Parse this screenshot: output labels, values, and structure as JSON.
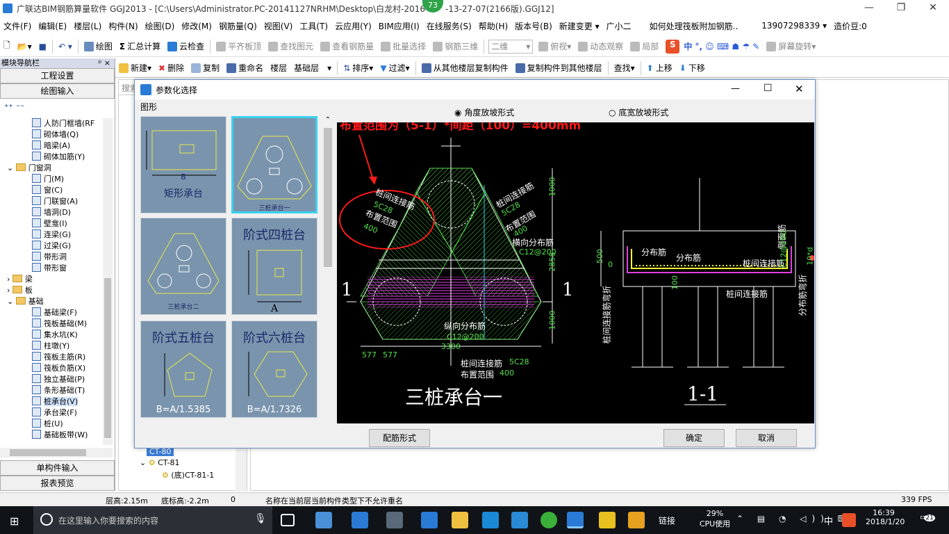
{
  "window": {
    "title": "广联达BIM钢筋算量软件 GGJ2013 - [C:\\Users\\Administrator.PC-20141127NRHM\\Desktop\\白龙村-2016",
    "title_tail": "-13-27-07(2166版).GGJ12]",
    "badge": "73"
  },
  "menu": [
    "文件(F)",
    "编辑(E)",
    "楼层(L)",
    "构件(N)",
    "绘图(D)",
    "修改(M)",
    "钢筋量(Q)",
    "视图(V)",
    "工具(T)",
    "云应用(Y)",
    "BIM应用(I)",
    "在线服务(S)",
    "帮助(H)",
    "版本号(B)",
    "新建变更 ▾",
    "广小二",
    "如何处理筏板附加钢筋..",
    "13907298339 ▾",
    "造价豆:0"
  ],
  "toolbar1": {
    "draw": "绘图",
    "sum": "汇总计算",
    "cloud": "云检查",
    "align": "平齐板顶",
    "find": "查找图元",
    "view_steel": "查看钢筋量",
    "batch": "批量选择",
    "steel3d": "钢筋三维",
    "mode": "二维",
    "view": "俯视",
    "dyn": "动态观察",
    "local": "局部",
    "rotate": "屏幕旋转"
  },
  "toolbar2": {
    "new": "新建",
    "delete": "删除",
    "copy": "复制",
    "rename": "重命名",
    "floor_label": "楼层",
    "floor_value": "基础层",
    "sort": "排序",
    "filter": "过滤",
    "copy_from": "从其他楼层复制构件",
    "copy_to": "复制构件到其他楼层",
    "search": "查找",
    "up": "上移",
    "down": "下移"
  },
  "left_panel": {
    "header": "模块导航栏",
    "pin": "ᵖ ×",
    "btn_settings": "工程设置",
    "btn_draw": "绘图输入",
    "btn_single": "单构件输入",
    "btn_report": "报表预览",
    "search_placeholder": "搜索"
  },
  "tree": [
    {
      "t": "人防门框墙(RF",
      "lvl": 3,
      "ic": "tic"
    },
    {
      "t": "砌体墙(Q)",
      "lvl": 3,
      "ic": "tic"
    },
    {
      "t": "暗梁(A)",
      "lvl": 3,
      "ic": "tic"
    },
    {
      "t": "砌体加筋(Y)",
      "lvl": 3,
      "ic": "tic"
    },
    {
      "t": "门窗洞",
      "lvl": 1,
      "ic": "fold",
      "exp": "⌄"
    },
    {
      "t": "门(M)",
      "lvl": 3,
      "ic": "tic"
    },
    {
      "t": "窗(C)",
      "lvl": 3,
      "ic": "tic"
    },
    {
      "t": "门联窗(A)",
      "lvl": 3,
      "ic": "tic"
    },
    {
      "t": "墙洞(D)",
      "lvl": 3,
      "ic": "tic"
    },
    {
      "t": "壁龛(I)",
      "lvl": 3,
      "ic": "tic"
    },
    {
      "t": "连梁(G)",
      "lvl": 3,
      "ic": "tic"
    },
    {
      "t": "过梁(G)",
      "lvl": 3,
      "ic": "tic"
    },
    {
      "t": "带形洞",
      "lvl": 3,
      "ic": "tic"
    },
    {
      "t": "带形窗",
      "lvl": 3,
      "ic": "tic"
    },
    {
      "t": "梁",
      "lvl": 1,
      "ic": "fold",
      "exp": "›"
    },
    {
      "t": "板",
      "lvl": 1,
      "ic": "fold",
      "exp": "›"
    },
    {
      "t": "基础",
      "lvl": 1,
      "ic": "fold",
      "exp": "⌄"
    },
    {
      "t": "基础梁(F)",
      "lvl": 3,
      "ic": "tic"
    },
    {
      "t": "筏板基础(M)",
      "lvl": 3,
      "ic": "tic"
    },
    {
      "t": "集水坑(K)",
      "lvl": 3,
      "ic": "tic"
    },
    {
      "t": "柱墩(Y)",
      "lvl": 3,
      "ic": "tic"
    },
    {
      "t": "筏板主筋(R)",
      "lvl": 3,
      "ic": "tic"
    },
    {
      "t": "筏板负筋(X)",
      "lvl": 3,
      "ic": "tic"
    },
    {
      "t": "独立基础(P)",
      "lvl": 3,
      "ic": "tic"
    },
    {
      "t": "条形基础(T)",
      "lvl": 3,
      "ic": "tic"
    },
    {
      "t": "桩承台(V)",
      "lvl": 3,
      "ic": "tic",
      "sel": true
    },
    {
      "t": "承台梁(F)",
      "lvl": 3,
      "ic": "tic"
    },
    {
      "t": "桩(U)",
      "lvl": 3,
      "ic": "tic"
    },
    {
      "t": "基础板带(W)",
      "lvl": 3,
      "ic": "tic"
    }
  ],
  "comp_tree": {
    "item1": "CT-80",
    "item2": "CT-81",
    "item3": "(底)CT-81-1"
  },
  "dialog": {
    "title": "参数化选择",
    "shapes_label": "图形",
    "radio1": "角度放坡形式",
    "radio2": "底宽放坡形式",
    "thumbs": [
      {
        "label": "矩形承台",
        "sub": "B"
      },
      {
        "label": "三桩承台一",
        "sub": ""
      },
      {
        "label": "三桩承台二",
        "sub": ""
      },
      {
        "label": "阶式四桩台",
        "sub": "A"
      },
      {
        "label": "阶式五桩台",
        "sub": "B=A/1.5385"
      },
      {
        "label": "阶式六桩台",
        "sub": "B=A/1.7326"
      }
    ],
    "btn_config": "配筋形式",
    "btn_ok": "确定",
    "btn_cancel": "取消"
  },
  "drawing": {
    "annotation": "布置范围为（5-1）*间距（100）=400mm",
    "left_label_1": "桩间连接筋",
    "left_label_2": "5C28",
    "left_label_3": "布置范围",
    "left_label_4": "400",
    "right_label_1": "桩间连接筋",
    "right_label_2": "5C28",
    "right_label_3": "布置范围",
    "right_label_4": "400",
    "trans_label": "横向分布筋",
    "trans_val": "C12@200",
    "long_label": "纵向分布筋",
    "long_val": "C12@200",
    "bottom_label_1": "桩间连接筋",
    "bottom_label_2": "5C28",
    "bottom_label_3": "布置范围",
    "bottom_label_4": "400",
    "dim_1000a": "1000",
    "dim_2858": "2858",
    "dim_1000b": "1000",
    "dim_3300": "3300",
    "dim_577a": "577",
    "dim_577b": "577",
    "sec_mark": "1",
    "title_main": "三桩承台一",
    "title_sec": "1-1",
    "sec_dist1": "分布筋",
    "sec_dist2": "分布筋",
    "sec_link": "桩间连接筋",
    "sec_link2": "桩间连接筋",
    "sec_side": "侧面筋",
    "sec_side_val": "C12@200",
    "sec_10d": "10*d",
    "sec_500": "500",
    "sec_0": "0",
    "sec_100": "100",
    "sec_bend_left": "桩间连接筋弯折",
    "sec_bend_right": "分布筋弯折"
  },
  "status": {
    "floor_h": "层高:2.15m",
    "bottom_h": "底标高:-2.2m",
    "zero": "0",
    "msg": "名称在当前层当前构件类型下不允许重名",
    "fps": "339 FPS"
  },
  "taskbar": {
    "search": "在这里输入你要搜索的内容",
    "link": "链接",
    "cpu_pct": "29%",
    "cpu_label": "CPU使用",
    "ime": "中",
    "time": "16:39",
    "date": "2018/1/20",
    "notif": "21"
  },
  "colors": {
    "accent": "#2a7bd6",
    "canvas": "#000000",
    "hatch": "#53e04a",
    "magenta": "#e040e0",
    "annotation": "#ff1a1a"
  }
}
